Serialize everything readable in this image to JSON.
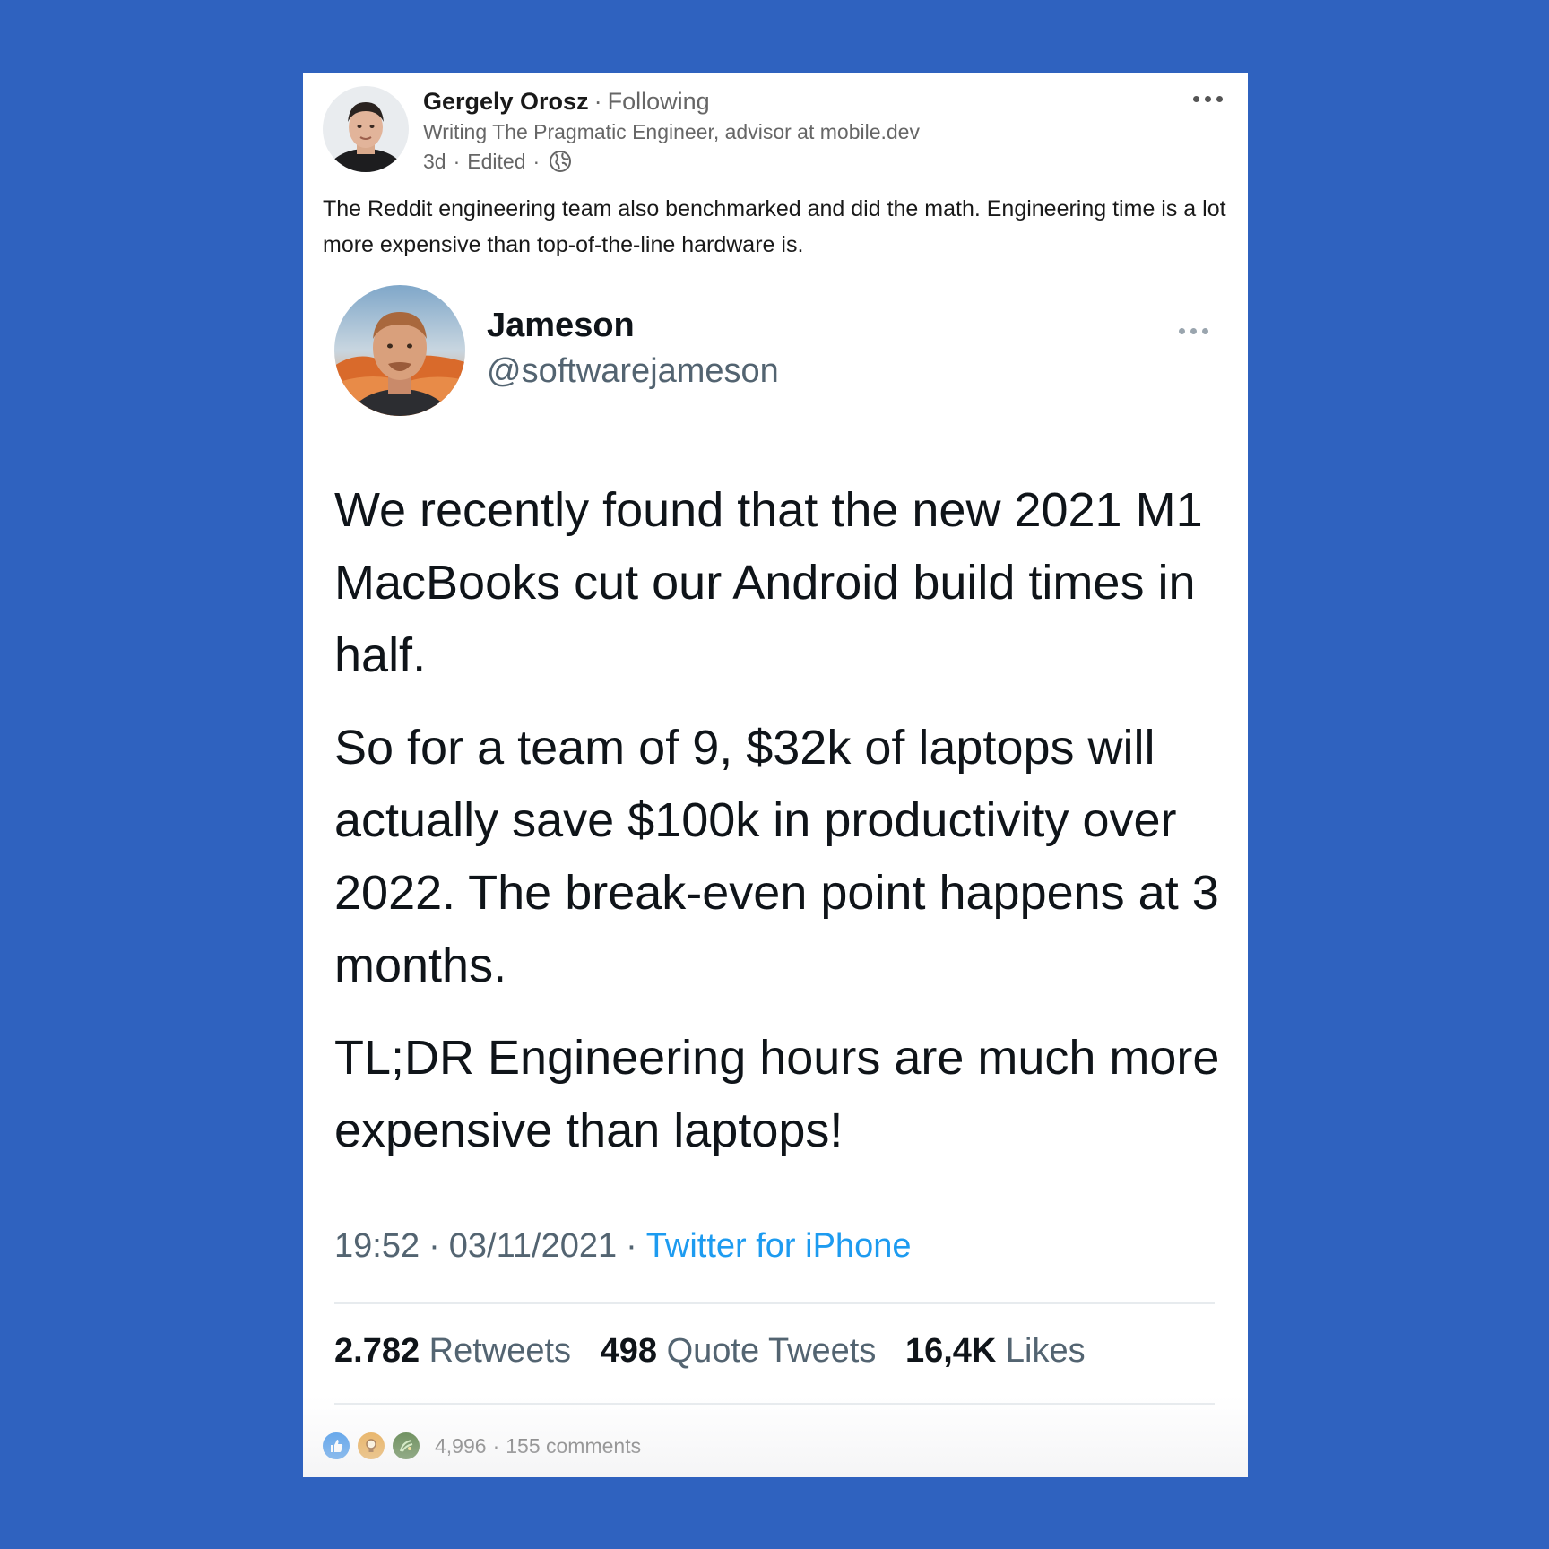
{
  "post": {
    "author": {
      "name": "Gergely Orosz",
      "relation": "Following",
      "headline": "Writing The Pragmatic Engineer, advisor at mobile.dev",
      "age": "3d",
      "edited": "Edited",
      "visibility_icon": "globe-icon"
    },
    "commentary": "The Reddit engineering team also benchmarked and did the math. Engineering time is a lot more expensive than top-of-the-line hardware is."
  },
  "tweet": {
    "name": "Jameson",
    "handle": "@softwarejameson",
    "paragraphs": [
      "We recently found that the new 2021 M1 MacBooks cut our Android build times in half.",
      "So for a team of 9, $32k of laptops will actually save $100k in productivity over 2022. The break-even point happens at 3 months.",
      "TL;DR Engineering hours are much more expensive than laptops!"
    ],
    "time": "19:52",
    "date": "03/11/2021",
    "source": "Twitter for iPhone",
    "stats": {
      "retweets_count": "2.782",
      "retweets_label": "Retweets",
      "quotes_count": "498",
      "quotes_label": "Quote Tweets",
      "likes_count": "16,4K",
      "likes_label": "Likes"
    }
  },
  "social": {
    "reaction_icons": [
      "like-icon",
      "insightful-icon",
      "celebrate-icon"
    ],
    "reactions_count": "4,996",
    "comments": "155 comments"
  },
  "colors": {
    "background": "#2F62BF",
    "twitter_link": "#1d9bf0",
    "like_blue": "#378fe9",
    "insightful_orange": "#e7a33e",
    "celebrate_green": "#44712e"
  }
}
